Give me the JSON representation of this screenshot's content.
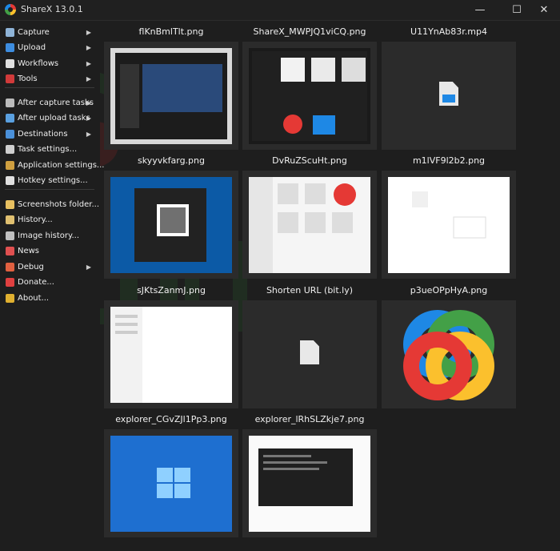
{
  "window": {
    "title": "ShareX 13.0.1",
    "minimize_glyph": "—",
    "maximize_glyph": "☐",
    "close_glyph": "✕"
  },
  "menu": [
    {
      "label": "Capture",
      "arrow": true,
      "icon": "capture-icon",
      "color": "#8fb4d8"
    },
    {
      "label": "Upload",
      "arrow": true,
      "icon": "upload-icon",
      "color": "#3d8de0"
    },
    {
      "label": "Workflows",
      "arrow": true,
      "icon": "workflows-icon",
      "color": "#e0e0e0"
    },
    {
      "label": "Tools",
      "arrow": true,
      "icon": "tools-icon",
      "color": "#d13a3a"
    },
    {
      "label": "After capture tasks",
      "arrow": true,
      "icon": "after-capture-icon",
      "color": "#bbbbbb"
    },
    {
      "label": "After upload tasks",
      "arrow": true,
      "icon": "after-upload-icon",
      "color": "#5aa0e0"
    },
    {
      "label": "Destinations",
      "arrow": true,
      "icon": "destinations-icon",
      "color": "#4a90d9"
    },
    {
      "label": "Task settings...",
      "arrow": false,
      "icon": "gear-icon",
      "color": "#cfcfcf"
    },
    {
      "label": "Application settings...",
      "arrow": false,
      "icon": "wrench-icon",
      "color": "#d0a040"
    },
    {
      "label": "Hotkey settings...",
      "arrow": false,
      "icon": "keyboard-icon",
      "color": "#e0e0e0"
    },
    {
      "label": "Screenshots folder...",
      "arrow": false,
      "icon": "folder-icon",
      "color": "#e8c060"
    },
    {
      "label": "History...",
      "arrow": false,
      "icon": "history-icon",
      "color": "#e0c070"
    },
    {
      "label": "Image history...",
      "arrow": false,
      "icon": "image-history-icon",
      "color": "#c0c0c0"
    },
    {
      "label": "News",
      "arrow": false,
      "icon": "news-icon",
      "color": "#e05050"
    },
    {
      "label": "Debug",
      "arrow": true,
      "icon": "debug-icon",
      "color": "#e06040"
    },
    {
      "label": "Donate...",
      "arrow": false,
      "icon": "heart-icon",
      "color": "#e04040"
    },
    {
      "label": "About...",
      "arrow": false,
      "icon": "crown-icon",
      "color": "#e0b030"
    }
  ],
  "thumbnails": [
    {
      "caption": "flKnBmlTlt.png",
      "kind": "screenshot"
    },
    {
      "caption": "ShareX_MWPJQ1viCQ.png",
      "kind": "screenshot"
    },
    {
      "caption": "U11YnAb83r.mp4",
      "kind": "video"
    },
    {
      "caption": "skyyvkfarg.png",
      "kind": "screenshot"
    },
    {
      "caption": "DvRuZScuHt.png",
      "kind": "screenshot"
    },
    {
      "caption": "m1lVF9l2b2.png",
      "kind": "screenshot"
    },
    {
      "caption": "sJKtsZanmJ.png",
      "kind": "screenshot"
    },
    {
      "caption": "Shorten URL (bit.ly)",
      "kind": "file"
    },
    {
      "caption": "p3ueOPpHyA.png",
      "kind": "logo"
    },
    {
      "caption": "explorer_CGvZJl1Pp3.png",
      "kind": "screenshot"
    },
    {
      "caption": "explorer_lRhSLZkje7.png",
      "kind": "screenshot"
    }
  ]
}
